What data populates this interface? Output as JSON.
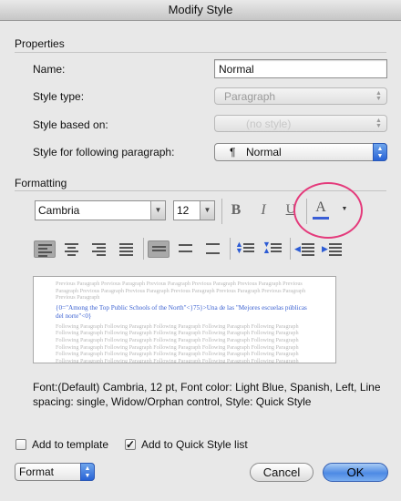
{
  "window": {
    "title": "Modify Style"
  },
  "properties": {
    "section_label": "Properties",
    "name_label": "Name:",
    "name_value": "Normal",
    "style_type_label": "Style type:",
    "style_type_value": "Paragraph",
    "style_based_on_label": "Style based on:",
    "style_based_on_value": "(no style)",
    "following_label": "Style for following paragraph:",
    "following_icon": "¶",
    "following_value": "Normal"
  },
  "formatting": {
    "section_label": "Formatting",
    "font_name": "Cambria",
    "font_size": "12",
    "bold": "B",
    "italic": "I",
    "underline": "U",
    "font_color_letter": "A",
    "font_color_bar": "#3a5ed6",
    "highlight_ring_color": "#e43a7b"
  },
  "paragraph_buttons": [
    "align-left-icon",
    "align-center-icon",
    "align-right-icon",
    "justify-icon",
    "single-spacing-icon",
    "one-half-spacing-icon",
    "double-spacing-icon",
    "space-before-icon",
    "space-after-icon",
    "decrease-indent-icon",
    "increase-indent-icon"
  ],
  "preview": {
    "previous_text": "Previous Paragraph Previous Paragraph Previous Paragraph Previous Paragraph Previous Paragraph Previous Paragraph Previous Paragraph Previous Paragraph Previous Paragraph Previous Paragraph Previous Paragraph Previous Paragraph",
    "current_text": "{0=\"Among the Top Public Schools of the North\"<}75}>Una de las \"Mejores escuelas públicas del norte\"<0}",
    "following_text": "Following Paragraph Following Paragraph Following Paragraph Following Paragraph Following Paragraph Following Paragraph Following Paragraph Following Paragraph Following Paragraph Following Paragraph Following Paragraph Following Paragraph Following Paragraph Following Paragraph Following Paragraph Following Paragraph Following Paragraph Following Paragraph Following Paragraph Following Paragraph Following Paragraph Following Paragraph Following Paragraph Following Paragraph Following Paragraph Following Paragraph Following Paragraph Following Paragraph Following Paragraph Following Paragraph Following Paragraph Following Paragraph Following Paragraph Following Paragraph Following Paragraph Following Paragraph Following Paragraph Following Paragraph Following Paragraph Following Paragraph Following Paragraph"
  },
  "summary": "Font:(Default) Cambria, 12 pt, Font color: Light Blue, Spanish, Left, Line spacing:  single, Widow/Orphan control, Style: Quick Style",
  "options": {
    "add_to_template_label": "Add to template",
    "add_to_template_checked": false,
    "add_to_quick_style_label": "Add to Quick Style list",
    "add_to_quick_style_check": "✓"
  },
  "footer": {
    "format_label": "Format",
    "cancel_label": "Cancel",
    "ok_label": "OK"
  }
}
